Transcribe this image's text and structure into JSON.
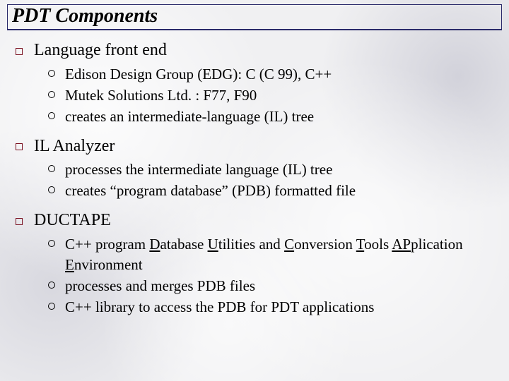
{
  "title": "PDT Components",
  "sections": [
    {
      "heading": "Language front end",
      "items": [
        {
          "html": "Edison Design Group (EDG): C (C 99), C++"
        },
        {
          "html": "Mutek Solutions Ltd. : F77, F90"
        },
        {
          "html": "creates an intermediate-language (IL) tree"
        }
      ]
    },
    {
      "heading": "IL Analyzer",
      "items": [
        {
          "html": "processes the intermediate language (IL) tree"
        },
        {
          "html": "creates “program database” (PDB) formatted file"
        }
      ]
    },
    {
      "heading": "DUCTAPE",
      "items": [
        {
          "html": "C++ program <span class='u'>D</span>atabase <span class='u'>U</span>tilities and <span class='u'>C</span>onversion <span class='u'>T</span>ools <span class='u'>AP</span>plication <span class='u'>E</span>nvironment"
        },
        {
          "html": "processes and merges PDB files"
        },
        {
          "html": "C++ library to access the PDB for PDT applications"
        }
      ]
    }
  ]
}
